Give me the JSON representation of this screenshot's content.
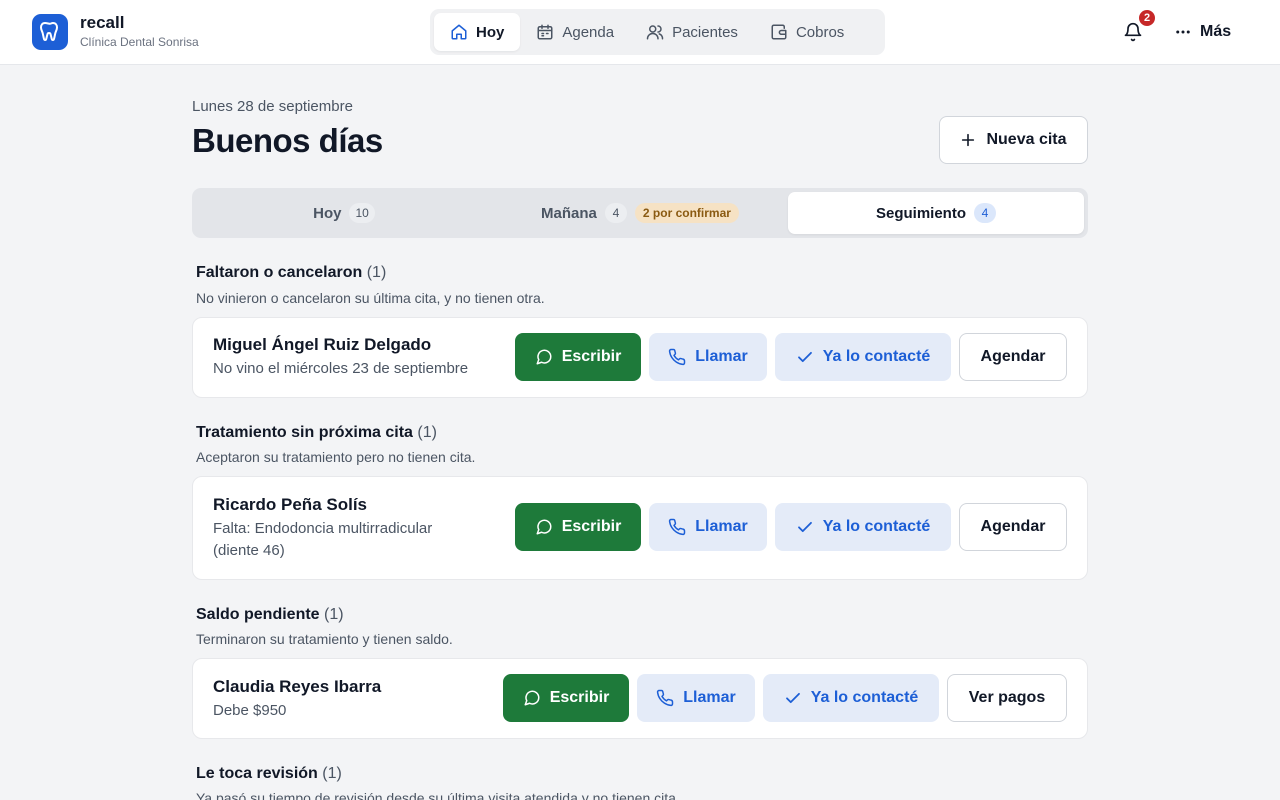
{
  "brand": {
    "name": "recall",
    "subtitle": "Clínica Dental Sonrisa",
    "logo_icon": "tooth-icon",
    "accent": "#1d5fd6"
  },
  "nav": {
    "items": [
      {
        "label": "Hoy",
        "icon": "home-icon",
        "active": true
      },
      {
        "label": "Agenda",
        "icon": "calendar-icon",
        "active": false
      },
      {
        "label": "Pacientes",
        "icon": "users-icon",
        "active": false
      },
      {
        "label": "Cobros",
        "icon": "wallet-icon",
        "active": false
      }
    ]
  },
  "notifications": {
    "count": "2",
    "icon": "bell-icon",
    "badge_color": "#c62828"
  },
  "more": {
    "label": "Más",
    "icon": "more-horizontal-icon"
  },
  "header": {
    "date": "Lunes 28 de septiembre",
    "greeting": "Buenos días",
    "new_appointment_label": "Nueva cita"
  },
  "tabs": [
    {
      "label": "Hoy",
      "count": "10",
      "active": false
    },
    {
      "label": "Mañana",
      "count": "4",
      "pill": "2 por confirmar",
      "active": false
    },
    {
      "label": "Seguimiento",
      "count": "4",
      "active": true
    }
  ],
  "sections": [
    {
      "title": "Faltaron o cancelaron",
      "count": "(1)",
      "description": "No vinieron o cancelaron su última cita, y no tienen otra.",
      "patient": {
        "name": "Miguel Ángel Ruiz Delgado",
        "note": "No vino el miércoles 23 de septiembre"
      },
      "actions": {
        "write": "Escribir",
        "call": "Llamar",
        "contacted": "Ya lo contacté",
        "secondary": "Agendar"
      }
    },
    {
      "title": "Tratamiento sin próxima cita",
      "count": "(1)",
      "description": "Aceptaron su tratamiento pero no tienen cita.",
      "patient": {
        "name": "Ricardo Peña Solís",
        "note": "Falta: Endodoncia multirradicular (diente 46)"
      },
      "actions": {
        "write": "Escribir",
        "call": "Llamar",
        "contacted": "Ya lo contacté",
        "secondary": "Agendar"
      }
    },
    {
      "title": "Saldo pendiente",
      "count": "(1)",
      "description": "Terminaron su tratamiento y tienen saldo.",
      "patient": {
        "name": "Claudia Reyes Ibarra",
        "note": "Debe $950"
      },
      "actions": {
        "write": "Escribir",
        "call": "Llamar",
        "contacted": "Ya lo contacté",
        "secondary": "Ver pagos"
      }
    },
    {
      "title": "Le toca revisión",
      "count": "(1)",
      "description": "Ya pasó su tiempo de revisión desde su última visita atendida y no tienen cita."
    }
  ],
  "colors": {
    "primary_action": "#1e7a3a",
    "secondary_action_bg": "#e4ebf8",
    "secondary_action_text": "#1d5fd6",
    "pending_pill_bg": "#f6e2c4"
  }
}
